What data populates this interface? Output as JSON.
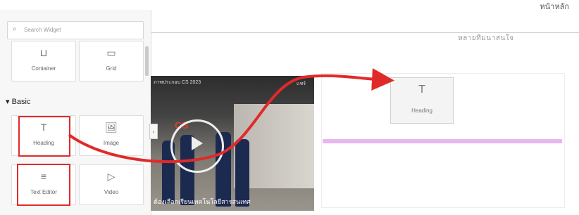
{
  "header": {
    "top_right_label": "หน้าหลัก"
  },
  "canvas": {
    "subtitle": "หลายทีมนาสนใจ"
  },
  "panel": {
    "search_placeholder": "Search Widget",
    "section_label": "Basic",
    "widgets": [
      {
        "label": "Container",
        "icon": "container-icon",
        "glyph": "⊔"
      },
      {
        "label": "Grid",
        "icon": "grid-icon",
        "glyph": "▭"
      },
      {
        "label": "Heading",
        "icon": "heading-icon",
        "glyph": "T"
      },
      {
        "label": "Image",
        "icon": "image-icon",
        "glyph": "🖼"
      },
      {
        "label": "Text Editor",
        "icon": "text-editor-icon",
        "glyph": "≡"
      },
      {
        "label": "Video",
        "icon": "video-icon",
        "glyph": "▷"
      }
    ]
  },
  "video": {
    "title": "ภาพประกอบ CS 2023",
    "share": "แชร์",
    "logo": "CS",
    "caption": "ต้องเลือกเรียนเทคโนโลยีสารสนเทศ"
  },
  "drop": {
    "label": "Heading",
    "glyph": "T"
  },
  "colors": {
    "highlight": "#e02a2a",
    "drop_line": "#e8b6f0"
  }
}
